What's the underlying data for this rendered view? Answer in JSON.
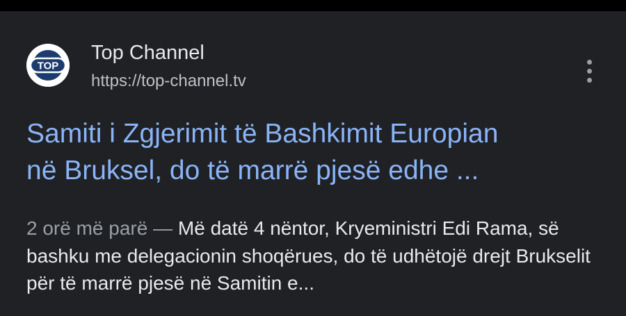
{
  "result": {
    "source": {
      "logo_icon": "top-channel-logo-icon",
      "name": "Top Channel",
      "url": "https://top-channel.tv"
    },
    "more_icon": "more-vert-icon",
    "title_line1": "Samiti i Zgjerimit të Bashkimit Europian",
    "title_line2": "në Bruksel, do të marrë pjesë edhe ...",
    "snippet": {
      "time": "2 orë më parë",
      "separator": "—",
      "text": "Më datë 4 nëntor, Kryeministri Edi Rama, së bashku me delegacionin shoqërues, do të udhëtojë drejt Brukselit për të marrë pjesë në Samitin e..."
    }
  },
  "colors": {
    "background": "#202124",
    "title_link": "#8ab4f8",
    "text_primary": "#e8eaed",
    "text_secondary": "#bdc1c6",
    "logo_navy": "#1c3b6e"
  }
}
